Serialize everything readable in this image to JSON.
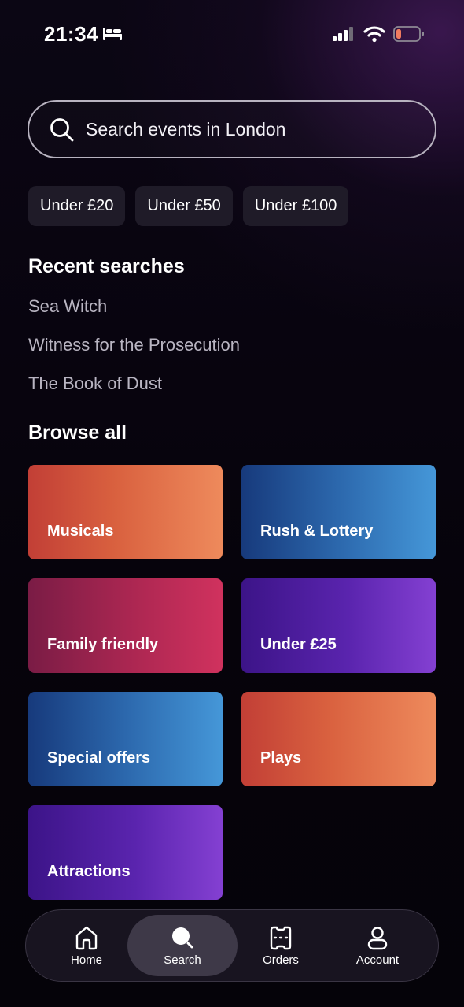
{
  "status_bar": {
    "time": "21:34",
    "icons": [
      "bed-icon",
      "signal-icon",
      "wifi-icon",
      "battery-icon"
    ],
    "battery_level": 0.15,
    "battery_color": "#f07b5f"
  },
  "search": {
    "placeholder": "Search events in London",
    "value": ""
  },
  "price_filters": [
    "Under £20",
    "Under £50",
    "Under £100"
  ],
  "recent": {
    "title": "Recent searches",
    "items": [
      "Sea Witch",
      "Witness for the Prosecution",
      "The Book of Dust"
    ]
  },
  "browse": {
    "title": "Browse all",
    "categories": [
      {
        "label": "Musicals",
        "color": "#d9613f"
      },
      {
        "label": "Rush & Lottery",
        "color": "#2c68ad"
      },
      {
        "label": "Family friendly",
        "color": "#ad2752"
      },
      {
        "label": "Under £25",
        "color": "#5a24ae"
      },
      {
        "label": "Special offers",
        "color": "#2c68ad"
      },
      {
        "label": "Plays",
        "color": "#d9613f"
      },
      {
        "label": "Attractions",
        "color": "#5a24ae"
      }
    ]
  },
  "bottom_nav": {
    "active": "Search",
    "items": [
      {
        "label": "Home",
        "icon": "home-icon"
      },
      {
        "label": "Search",
        "icon": "search-icon"
      },
      {
        "label": "Orders",
        "icon": "ticket-icon"
      },
      {
        "label": "Account",
        "icon": "user-icon"
      }
    ]
  }
}
